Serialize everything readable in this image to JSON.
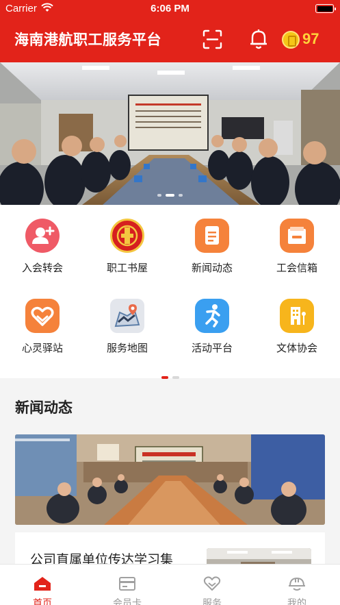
{
  "status_bar": {
    "carrier": "Carrier",
    "time": "6:06 PM"
  },
  "header": {
    "title": "海南港航职工服务平台",
    "coins": "97"
  },
  "banner": {
    "slide_count": 3,
    "active_slide": 2
  },
  "features": [
    {
      "label": "入会转会",
      "icon": "user-add-icon",
      "color": "#ef5a66"
    },
    {
      "label": "职工书屋",
      "icon": "union-emblem-icon",
      "color": "#d61f1f"
    },
    {
      "label": "新闻动态",
      "icon": "news-document-icon",
      "color": "#f5823b"
    },
    {
      "label": "工会信箱",
      "icon": "mailbox-icon",
      "color": "#f5823b"
    },
    {
      "label": "心灵驿站",
      "icon": "heart-hands-icon",
      "color": "#f5823b"
    },
    {
      "label": "服务地图",
      "icon": "map-pin-icon",
      "color": "#5c7ea8"
    },
    {
      "label": "活动平台",
      "icon": "running-person-icon",
      "color": "#3a9ff0"
    },
    {
      "label": "文体协会",
      "icon": "building-icon",
      "color": "#f7b51c"
    }
  ],
  "grid_pager": {
    "page_count": 2,
    "active_page": 1
  },
  "news": {
    "section_title": "新闻动态",
    "headline": "公司直属单位传达学习集"
  },
  "tabbar": [
    {
      "label": "首页",
      "icon": "home-icon",
      "active": true
    },
    {
      "label": "会员卡",
      "icon": "member-card-icon",
      "active": false
    },
    {
      "label": "服务",
      "icon": "service-heart-icon",
      "active": false
    },
    {
      "label": "我的",
      "icon": "profile-helmet-icon",
      "active": false
    }
  ],
  "colors": {
    "brand_red": "#e2231a",
    "coin_gold": "#ffd23a"
  }
}
